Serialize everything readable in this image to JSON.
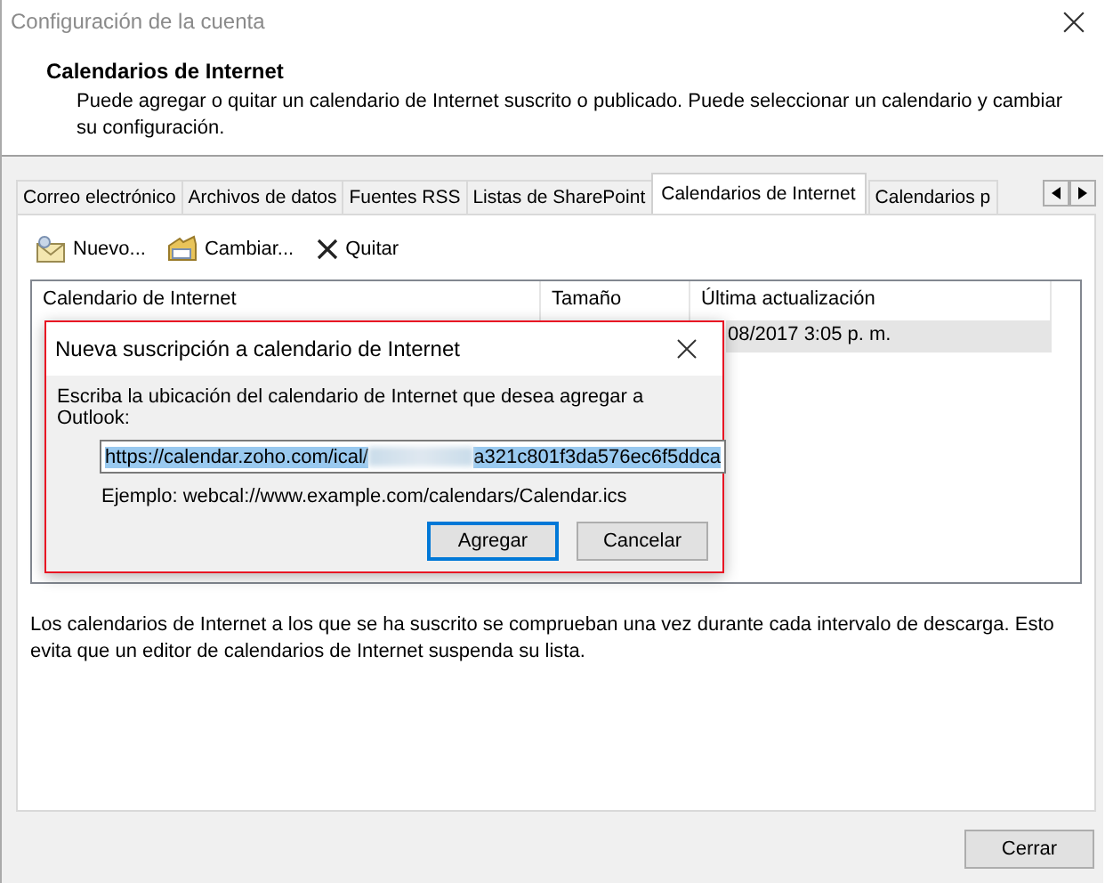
{
  "window": {
    "title": "Configuración de la cuenta"
  },
  "header": {
    "title": "Calendarios de Internet",
    "description": "Puede agregar o quitar un calendario de Internet suscrito o publicado. Puede seleccionar un calendario y cambiar su configuración."
  },
  "tabs": [
    {
      "label": "Correo electrónico",
      "selected": false
    },
    {
      "label": "Archivos de datos",
      "selected": false
    },
    {
      "label": "Fuentes RSS",
      "selected": false
    },
    {
      "label": "Listas de SharePoint",
      "selected": false
    },
    {
      "label": "Calendarios de Internet",
      "selected": true
    },
    {
      "label": "Calendarios p",
      "selected": false
    }
  ],
  "toolbar": [
    {
      "label": "Nuevo...",
      "kind": "new"
    },
    {
      "label": "Cambiar...",
      "kind": "change"
    },
    {
      "label": "Quitar",
      "kind": "remove"
    }
  ],
  "table": {
    "columns": [
      "Calendario de Internet",
      "Tamaño",
      "Última actualización"
    ],
    "rows": [
      {
        "column_3": "08/2017 3:05 p. m.",
        "selected": true
      }
    ]
  },
  "info": "Los calendarios de Internet a los que se ha suscrito se comprueban una vez durante cada intervalo de descarga. Esto evita que un editor de calendarios de Internet suspenda su lista.",
  "dialog": {
    "title": "Nueva suscripción a calendario de Internet",
    "prompt": "Escriba la ubicación del calendario de Internet que desea agregar a Outlook:",
    "url_start": "https://calendar.zoho.com/ical/",
    "url_end": "a321c801f3da576ec6f5ddca",
    "url_selected": true,
    "example": "Ejemplo: webcal://www.example.com/calendars/Calendar.ics",
    "buttons": [
      {
        "label": "Agregar",
        "default": true
      },
      {
        "label": "Cancelar",
        "default": false
      }
    ]
  },
  "buttons": [
    "Cerrar"
  ]
}
